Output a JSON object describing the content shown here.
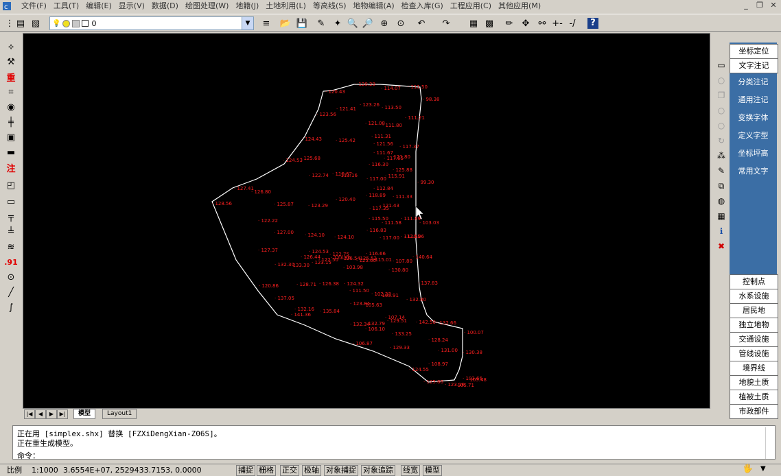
{
  "menu": [
    "文件(F)",
    "工具(T)",
    "编辑(E)",
    "显示(V)",
    "数据(D)",
    "绘图处理(W)",
    "地籍(J)",
    "土地利用(L)",
    "等高线(S)",
    "地物编辑(A)",
    "检查入库(G)",
    "工程应用(C)",
    "其他应用(M)"
  ],
  "toolbar": {
    "layer_value": "0"
  },
  "tabs": {
    "model": "模型",
    "layout": "Layout1"
  },
  "right_panel": {
    "top_buttons": [
      "坐标定位",
      "文字注记",
      "分类注记",
      "通用注记",
      "变换字体",
      "定义字型",
      "坐标坪高",
      "常用文字"
    ],
    "bottom_buttons": [
      "控制点",
      "水系设施",
      "居民地",
      "独立地物",
      "交通设施",
      "管线设施",
      "境界线",
      "地貌土质",
      "植被土质",
      "市政部件"
    ]
  },
  "command": {
    "line1": "正在用 [simplex.shx] 替换 [FZXiDengXian-Z06S]。",
    "line2": "正在重生成模型。",
    "prompt": "命令："
  },
  "status": {
    "scale_label": "比例",
    "scale": "1:1000",
    "coords": "3.6554E+07, 2529433.7153, 0.0000",
    "toggles": [
      "捕捉",
      "栅格",
      "正交",
      "极轴",
      "对象捕捉",
      "对象追踪",
      "线宽",
      "模型"
    ]
  },
  "left_text_icons": {
    "weight": "重",
    "note": "注",
    "num": ".91"
  },
  "colors": {
    "canvas": "#000000",
    "labels": "#ff2020",
    "boundary": "#ffffff",
    "panel_blue": "#3b6ea5"
  },
  "chart_data": {
    "type": "scatter",
    "labels": [
      "120.43",
      "120.29",
      "114.07",
      "111.50",
      "98.38",
      "121.41",
      "123.26",
      "113.50",
      "123.56",
      "111.21",
      "121.08",
      "111.80",
      "124.43",
      "125.42",
      "111.31",
      "121.56",
      "117.37",
      "111.67",
      "117.65",
      "121.80",
      "124.53",
      "125.68",
      "116.30",
      "116.67",
      "113.16",
      "125.88",
      "122.74",
      "115.91",
      "99.30",
      "127.41",
      "126.80",
      "117.00",
      "112.84",
      "128.56",
      "125.87",
      "123.29",
      "120.40",
      "118.89",
      "111.33",
      "117.35",
      "121.43",
      "122.22",
      "115.50",
      "111.58",
      "111.89",
      "103.03",
      "127.00",
      "124.10",
      "124.10",
      "116.83",
      "117.00",
      "112.55",
      "110.06",
      "127.37",
      "124.53",
      "116.66",
      "126.44",
      "122.50",
      "122.75",
      "126.54",
      "125.52",
      "115.01",
      "107.80",
      "132.30",
      "133.30",
      "123.15",
      "123.80",
      "125.60",
      "103.98",
      "130.80",
      "140.64",
      "128.71",
      "126.38",
      "124.32",
      "111.50",
      "102.23",
      "105.91",
      "137.83",
      "120.86",
      "137.05",
      "123.84",
      "105.63",
      "132.80",
      "132.16",
      "141.36",
      "135.84",
      "132.34",
      "132.79",
      "129.51",
      "107.14",
      "106.10",
      "142.50",
      "132.66",
      "100.07",
      "133.25",
      "128.24",
      "106.87",
      "130.38",
      "131.00",
      "129.33",
      "108.97",
      "124.55",
      "125.66",
      "123.16",
      "105.48",
      "105.71",
      "103.66"
    ]
  }
}
